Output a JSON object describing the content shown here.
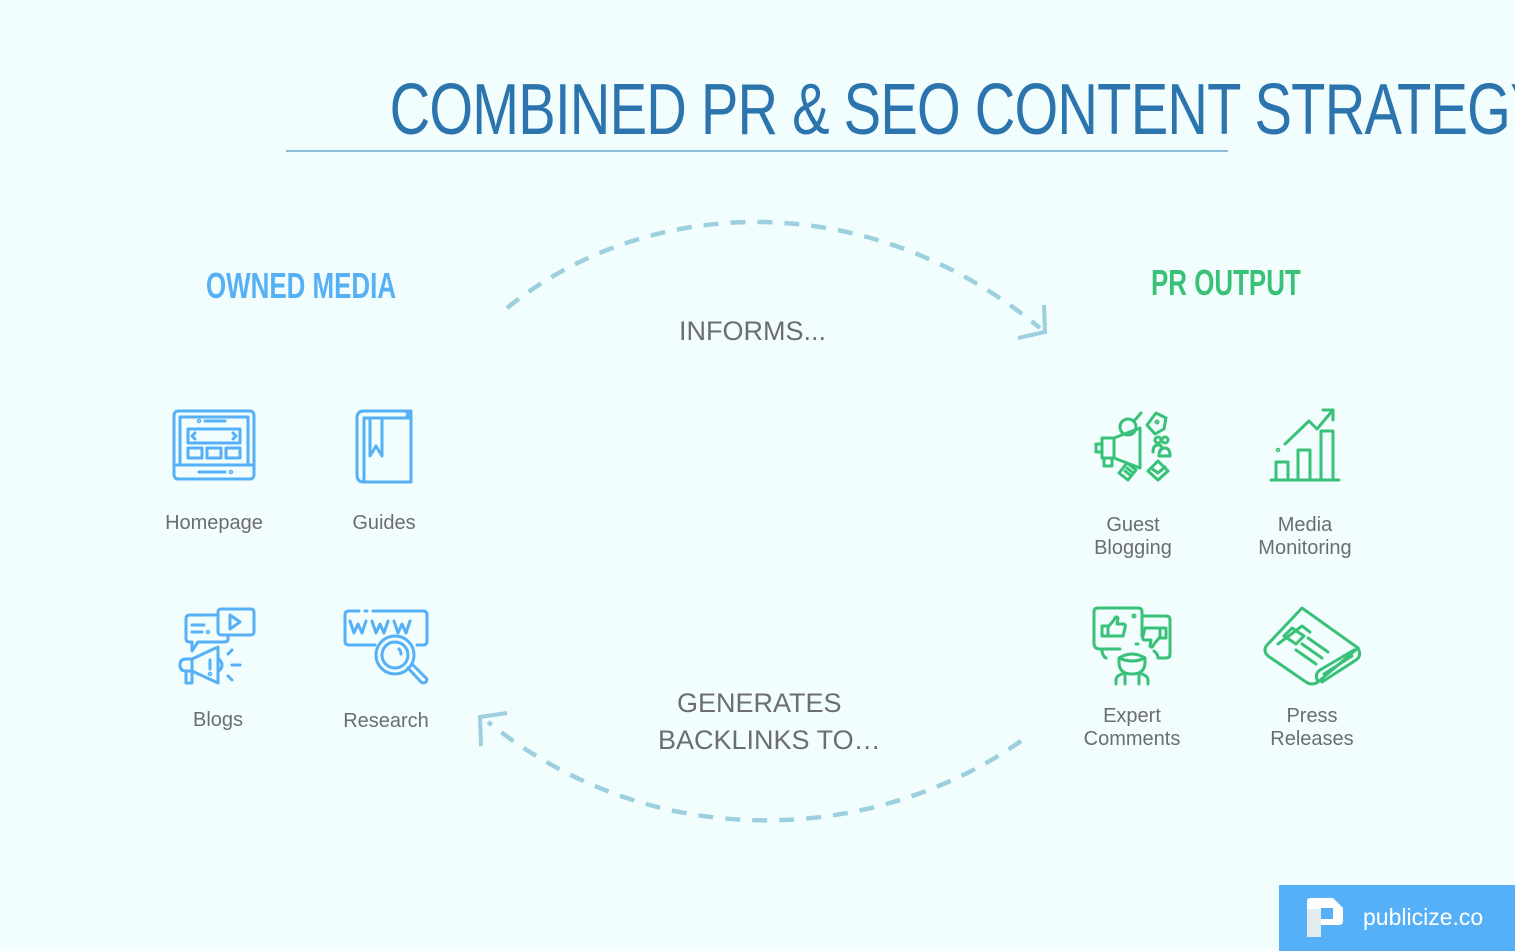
{
  "title": "COMBINED PR & SEO CONTENT STRATEGY",
  "colors": {
    "background": "#f2fdfe",
    "title": "#2b74ae",
    "owned_media": "#56b0f5",
    "pr_output": "#39c178",
    "arrow": "#9dd0de",
    "label_text": "#6d6d6d",
    "badge": "#56b0f8"
  },
  "owned_media": {
    "heading": "OWNED MEDIA",
    "items": [
      {
        "label": "Homepage",
        "icon": "laptop-website-icon"
      },
      {
        "label": "Guides",
        "icon": "book-bookmark-icon"
      },
      {
        "label": "Blogs",
        "icon": "megaphone-chat-video-icon"
      },
      {
        "label": "Research",
        "icon": "www-magnifier-icon"
      }
    ]
  },
  "pr_output": {
    "heading": "PR OUTPUT",
    "items": [
      {
        "label_line1": "Guest",
        "label_line2": "Blogging",
        "icon": "megaphone-marketing-icon"
      },
      {
        "label_line1": "Media",
        "label_line2": "Monitoring",
        "icon": "growth-chart-icon"
      },
      {
        "label_line1": "Expert",
        "label_line2": "Comments",
        "icon": "feedback-person-icon"
      },
      {
        "label_line1": "Press",
        "label_line2": "Releases",
        "icon": "newspaper-icon"
      }
    ]
  },
  "flows": {
    "top_label": "INFORMS...",
    "bottom_label_line1": "GENERATES",
    "bottom_label_line2": "BACKLINKS TO…"
  },
  "footer": {
    "brand": "publicize.co",
    "logo_icon": "publicize-p-logo-icon"
  }
}
